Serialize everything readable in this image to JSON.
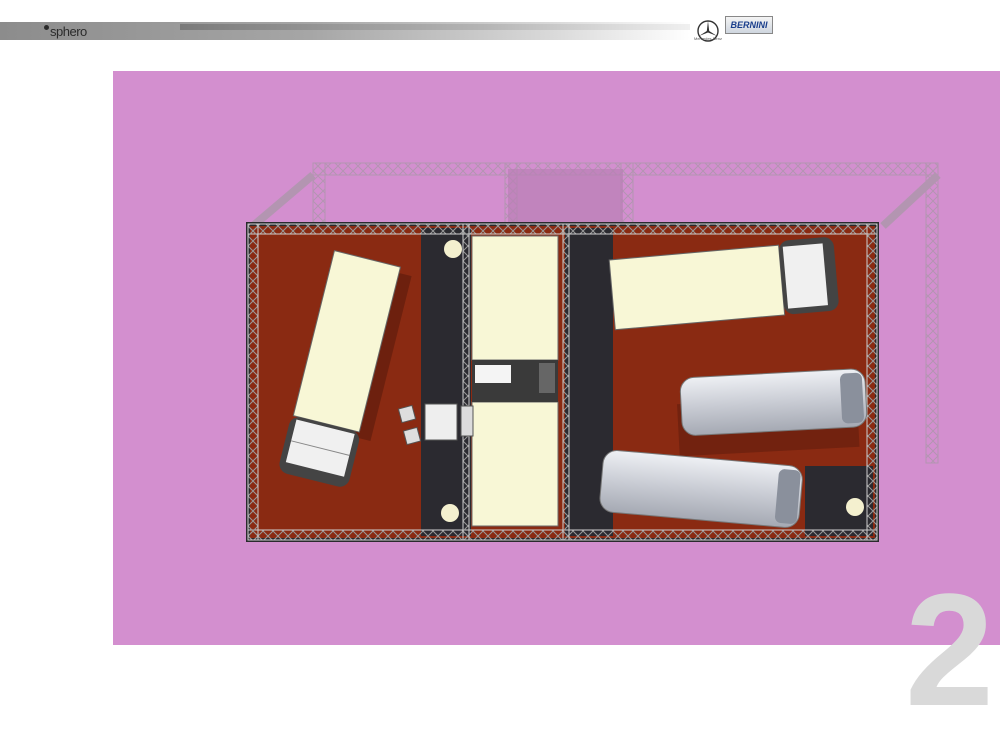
{
  "header": {
    "logo_text": "sphero",
    "brand_mercedes_caption": "Mercedes-Benz",
    "brand_bernini": "BERNINI"
  },
  "page_number": "2",
  "colors": {
    "canvas": "#d38fcf",
    "floor": "#8a2a12",
    "aisle": "#2b2a30",
    "panel": "#f8f7d6"
  }
}
